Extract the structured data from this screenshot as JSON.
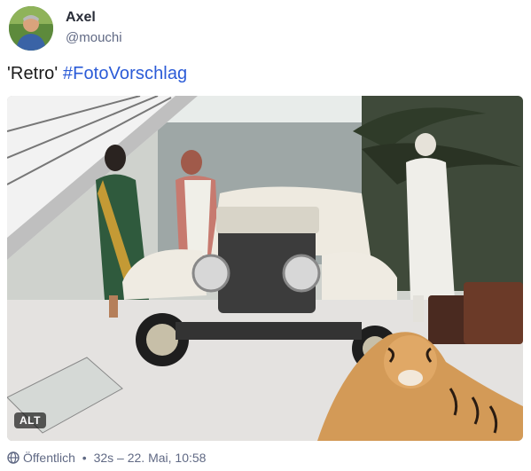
{
  "author": {
    "display_name": "Axel",
    "handle": "@mouchi",
    "avatar_icon": "avatar-photo"
  },
  "post": {
    "text_prefix": "'Retro' ",
    "hashtag": "#FotoVorschlag",
    "hashtag_color": "#2b5bd7"
  },
  "media": {
    "alt_badge": "ALT"
  },
  "footer": {
    "visibility_icon": "globe-icon",
    "visibility": "Öffentlich",
    "separator": " • ",
    "timestamp": "32s – 22. Mai, 10:58"
  }
}
